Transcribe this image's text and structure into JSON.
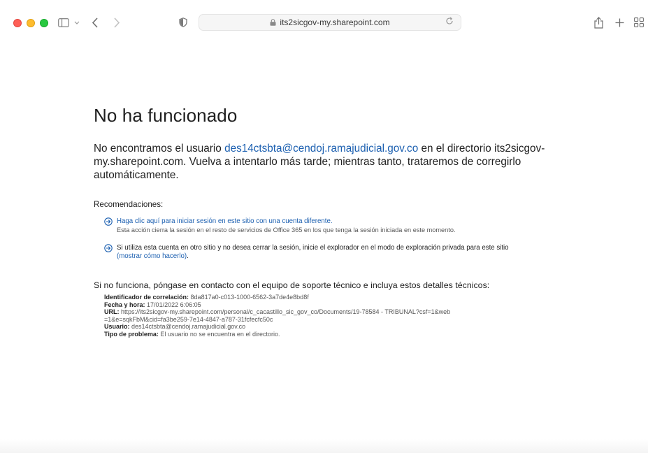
{
  "browser": {
    "url": "its2sicgov-my.sharepoint.com",
    "icons": {
      "sidebar": "sidebar-icon",
      "back": "chevron-left-icon",
      "forward": "chevron-right-icon",
      "privacy": "shield-icon",
      "lock": "lock-icon",
      "reload": "reload-icon",
      "share": "share-icon",
      "new_tab": "plus-icon",
      "tabs": "tab-overview-icon"
    },
    "colors": {
      "close": "#fe5f57",
      "minimize": "#febc2e",
      "zoom": "#28c840"
    }
  },
  "page": {
    "title": "No ha funcionado",
    "message": {
      "before": "No encontramos el usuario ",
      "email": "des14ctsbta@cendoj.ramajudicial.gov.co",
      "after": " en el directorio its2sicgov-my.sharepoint.com. Vuelva a intentarlo más tarde; mientras tanto, trataremos de corregirlo automáticamente."
    },
    "recommendations": {
      "title": "Recomendaciones:",
      "items": [
        {
          "link": "Haga clic aquí para iniciar sesión en este sitio con una cuenta diferente.",
          "sub": "Esta acción cierra la sesión en el resto de servicios de Office 365 en los que tenga la sesión iniciada en este momento."
        },
        {
          "text": "Si utiliza esta cuenta en otro sitio y no desea cerrar la sesión, inicie el explorador en el modo de exploración privada para este sitio",
          "link": "(mostrar cómo hacerlo)",
          "suffix": "."
        }
      ]
    },
    "support": {
      "intro": "Si no funciona, póngase en contacto con el equipo de soporte técnico e incluya estos detalles técnicos:",
      "details": [
        {
          "label": "Identificador de correlación:",
          "value": "8da817a0-c013-1000-6562-3a7de4e8bd8f"
        },
        {
          "label": "Fecha y hora:",
          "value": "17/01/2022 6:06:05"
        },
        {
          "label": "URL:",
          "value": "https://its2sicgov-my.sharepoint.com/personal/c_cacastillo_sic_gov_co/Documents/19-78584 - TRIBUNAL?csf=1&web=1&e=sqkFbM&cid=fa3be259-7e14-4847-a787-31fcfecfc50c"
        },
        {
          "label": "Usuario:",
          "value": "des14ctsbta@cendoj.ramajudicial.gov.co"
        },
        {
          "label": "Tipo de problema:",
          "value": "El usuario no se encuentra en el directorio."
        }
      ]
    },
    "colors": {
      "link": "#1b5fb0",
      "text": "#222222",
      "muted": "#555555"
    }
  }
}
